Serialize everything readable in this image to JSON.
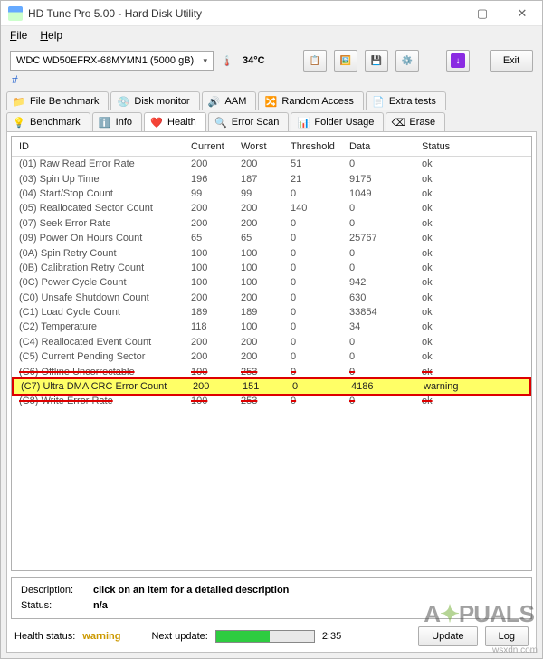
{
  "window": {
    "title": "HD Tune Pro 5.00 - Hard Disk Utility"
  },
  "menu": {
    "file": "File",
    "help": "Help"
  },
  "drive": "WDC WD50EFRX-68MYMN1 (5000 gB)",
  "temperature": "34°C",
  "exit_label": "Exit",
  "hash": "#",
  "tabs_row1": [
    {
      "icon": "📁",
      "label": "File Benchmark"
    },
    {
      "icon": "💿",
      "label": "Disk monitor"
    },
    {
      "icon": "🔊",
      "label": "AAM"
    },
    {
      "icon": "🔀",
      "label": "Random Access"
    },
    {
      "icon": "📄",
      "label": "Extra tests"
    }
  ],
  "tabs_row2": [
    {
      "icon": "💡",
      "label": "Benchmark"
    },
    {
      "icon": "ℹ️",
      "label": "Info"
    },
    {
      "icon": "❤️",
      "label": "Health"
    },
    {
      "icon": "🔍",
      "label": "Error Scan"
    },
    {
      "icon": "📊",
      "label": "Folder Usage"
    },
    {
      "icon": "⌫",
      "label": "Erase"
    }
  ],
  "columns": [
    "ID",
    "Current",
    "Worst",
    "Threshold",
    "Data",
    "Status"
  ],
  "rows": [
    {
      "id": "(01) Raw Read Error Rate",
      "c": "200",
      "w": "200",
      "t": "51",
      "d": "0",
      "s": "ok"
    },
    {
      "id": "(03) Spin Up Time",
      "c": "196",
      "w": "187",
      "t": "21",
      "d": "9175",
      "s": "ok"
    },
    {
      "id": "(04) Start/Stop Count",
      "c": "99",
      "w": "99",
      "t": "0",
      "d": "1049",
      "s": "ok"
    },
    {
      "id": "(05) Reallocated Sector Count",
      "c": "200",
      "w": "200",
      "t": "140",
      "d": "0",
      "s": "ok"
    },
    {
      "id": "(07) Seek Error Rate",
      "c": "200",
      "w": "200",
      "t": "0",
      "d": "0",
      "s": "ok"
    },
    {
      "id": "(09) Power On Hours Count",
      "c": "65",
      "w": "65",
      "t": "0",
      "d": "25767",
      "s": "ok"
    },
    {
      "id": "(0A) Spin Retry Count",
      "c": "100",
      "w": "100",
      "t": "0",
      "d": "0",
      "s": "ok"
    },
    {
      "id": "(0B) Calibration Retry Count",
      "c": "100",
      "w": "100",
      "t": "0",
      "d": "0",
      "s": "ok"
    },
    {
      "id": "(0C) Power Cycle Count",
      "c": "100",
      "w": "100",
      "t": "0",
      "d": "942",
      "s": "ok"
    },
    {
      "id": "(C0) Unsafe Shutdown Count",
      "c": "200",
      "w": "200",
      "t": "0",
      "d": "630",
      "s": "ok"
    },
    {
      "id": "(C1) Load Cycle Count",
      "c": "189",
      "w": "189",
      "t": "0",
      "d": "33854",
      "s": "ok"
    },
    {
      "id": "(C2) Temperature",
      "c": "118",
      "w": "100",
      "t": "0",
      "d": "34",
      "s": "ok"
    },
    {
      "id": "(C4) Reallocated Event Count",
      "c": "200",
      "w": "200",
      "t": "0",
      "d": "0",
      "s": "ok"
    },
    {
      "id": "(C5) Current Pending Sector",
      "c": "200",
      "w": "200",
      "t": "0",
      "d": "0",
      "s": "ok"
    },
    {
      "id": "(C6) Offline Uncorrectable",
      "c": "100",
      "w": "253",
      "t": "0",
      "d": "0",
      "s": "ok",
      "strike": true
    },
    {
      "id": "(C7) Ultra DMA CRC Error Count",
      "c": "200",
      "w": "151",
      "t": "0",
      "d": "4186",
      "s": "warning",
      "highlight": true,
      "redbox": true
    },
    {
      "id": "(C8) Write Error Rate",
      "c": "100",
      "w": "253",
      "t": "0",
      "d": "0",
      "s": "ok",
      "strike": true
    }
  ],
  "description": {
    "desc_label": "Description:",
    "desc_value": "click on an item for a detailed description",
    "status_label": "Status:",
    "status_value": "n/a"
  },
  "footer": {
    "health_label": "Health status:",
    "health_value": "warning",
    "next_label": "Next update:",
    "countdown": "2:35",
    "update_btn": "Update",
    "log_btn": "Log"
  },
  "watermark": "A PUALS",
  "url": "wsxdn.com"
}
